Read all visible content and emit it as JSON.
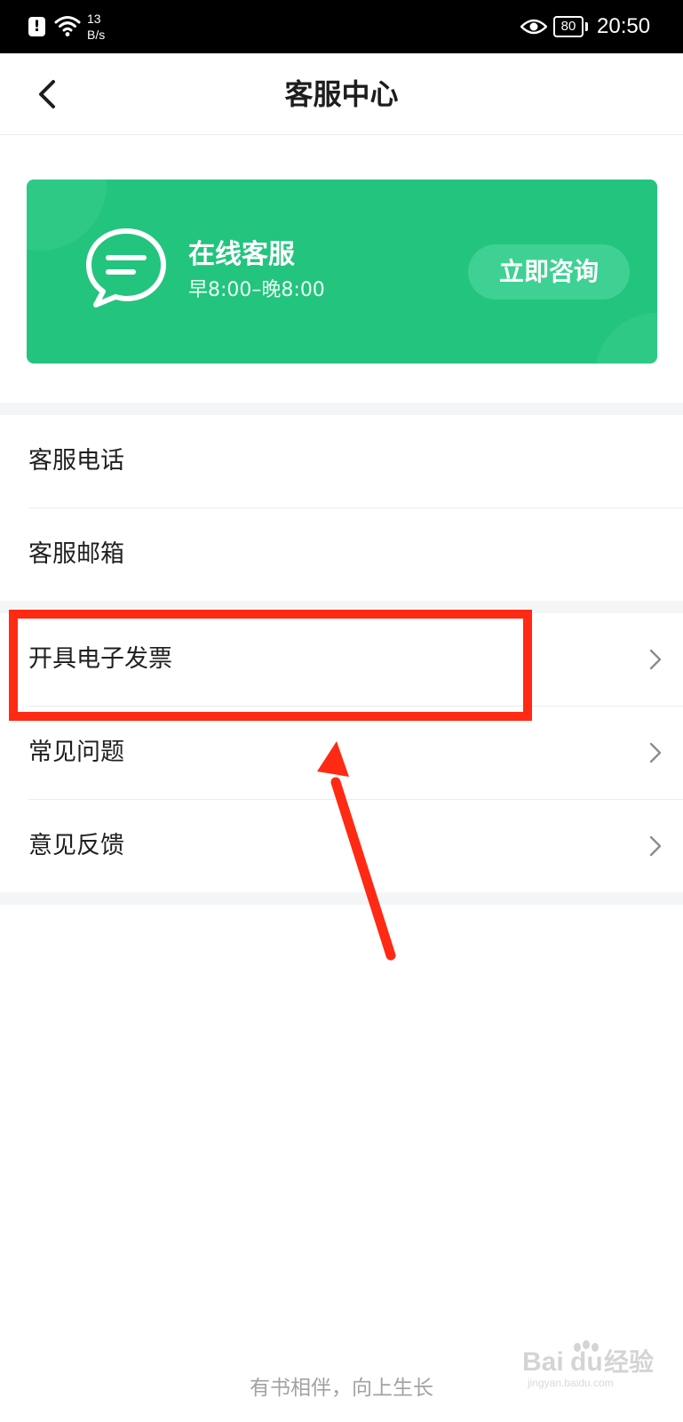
{
  "status_bar": {
    "net_speed_value": "13",
    "net_speed_unit": "B/s",
    "battery": "80",
    "time": "20:50",
    "icons": [
      "alert-icon",
      "wifi-icon",
      "eye-icon",
      "battery-icon"
    ]
  },
  "nav": {
    "title": "客服中心",
    "back_icon": "chevron-left-icon"
  },
  "banner": {
    "title": "在线客服",
    "hours": "早8:00–晚8:00",
    "button_label": "立即咨询",
    "icon": "chat-bubble-icon",
    "color": "#23c47e"
  },
  "menu": {
    "items": [
      {
        "label": "客服电话",
        "has_chevron": false
      },
      {
        "label": "客服邮箱",
        "has_chevron": false
      },
      {
        "label": "开具电子发票",
        "has_chevron": true
      },
      {
        "label": "常见问题",
        "has_chevron": true
      },
      {
        "label": "意见反馈",
        "has_chevron": true
      }
    ]
  },
  "annotation": {
    "highlight_color": "#ff2a14",
    "highlighted_item": "开具电子发票"
  },
  "footer": {
    "slogan": "有书相伴，向上生长"
  },
  "watermark": {
    "brand": "Bai",
    "brand_end": "du",
    "brand_cn": "经验",
    "domain": "jingyan.baidu.com"
  }
}
